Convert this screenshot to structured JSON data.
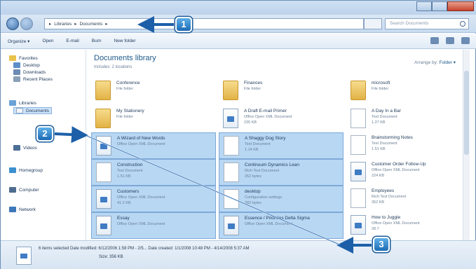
{
  "address": {
    "crumbs": [
      "Libraries",
      "Documents"
    ],
    "search_placeholder": "Search Documents"
  },
  "toolbar": {
    "items": [
      "Organize ▾",
      "Open",
      "E-mail",
      "Burn",
      "New folder"
    ]
  },
  "nav_pane": {
    "favorites": "Favorites",
    "desktop": "Desktop",
    "downloads": "Downloads",
    "recent_places": "Recent Places",
    "libraries": "Libraries",
    "documents": "Documents",
    "videos": "Videos",
    "homegroup": "Homegroup",
    "computer": "Computer",
    "network": "Network"
  },
  "library": {
    "title": "Documents library",
    "subtitle": "Includes: 2 locations",
    "arrange_label": "Arrange by:",
    "arrange_value": "Folder ▾"
  },
  "files": [
    {
      "name": "Conference",
      "type": "File folder",
      "size": "",
      "icon": "folder",
      "selected": false
    },
    {
      "name": "Finances",
      "type": "File folder",
      "size": "",
      "icon": "folder",
      "selected": false
    },
    {
      "name": "microsoft",
      "type": "File folder",
      "size": "",
      "icon": "folder",
      "selected": false
    },
    {
      "name": "My Stationery",
      "type": "File folder",
      "size": "",
      "icon": "folder",
      "selected": false
    },
    {
      "name": "A Draft E-mail Primer",
      "type": "Office Open XML Document",
      "size": "235 KB",
      "icon": "doc",
      "selected": false
    },
    {
      "name": "A Day In a Bar",
      "type": "Text Document",
      "size": "1.27 KB",
      "icon": "txt",
      "selected": false
    },
    {
      "name": "A Wizard of New Words",
      "type": "Office Open XML Document",
      "size": "",
      "icon": "doc",
      "selected": true
    },
    {
      "name": "A Shaggy Dog Story",
      "type": "Text Document",
      "size": "1.14 KB",
      "icon": "txt",
      "selected": true
    },
    {
      "name": "Brainstorming Notes",
      "type": "Text Document",
      "size": "1.51 KB",
      "icon": "txt",
      "selected": false
    },
    {
      "name": "Construction",
      "type": "Text Document",
      "size": "1.51 KB",
      "icon": "txt",
      "selected": true
    },
    {
      "name": "Continuum Dynamics Lean",
      "type": "Rich Text Document",
      "size": "262 bytes",
      "icon": "txt",
      "selected": true
    },
    {
      "name": "Customer Order Follow-Up",
      "type": "Office Open XML Document",
      "size": "224 KB",
      "icon": "doc",
      "selected": false
    },
    {
      "name": "Customers",
      "type": "Office Open XML Document",
      "size": "41.2 KB",
      "icon": "doc",
      "selected": true
    },
    {
      "name": "desktop",
      "type": "Configuration settings",
      "size": "282 bytes",
      "icon": "txt",
      "selected": true
    },
    {
      "name": "Employees",
      "type": "Rich Text Document",
      "size": "352 KB",
      "icon": "txt",
      "selected": false
    },
    {
      "name": "Essay",
      "type": "Office Open XML Document",
      "size": "",
      "icon": "doc",
      "selected": true
    },
    {
      "name": "Essence / Priorities Delta Sigma",
      "type": "Office Open XML Document",
      "size": "",
      "icon": "doc",
      "selected": true
    },
    {
      "name": "How to Juggle",
      "type": "Office Open XML Document",
      "size": "28.7",
      "icon": "doc",
      "selected": false
    }
  ],
  "details": {
    "line1": "6 items selected   Date modified: 6/12/2006 1:58 PM - 2/5...   Date created: 1/1/2008 10:48 PM - 4/14/2008 5:37 AM",
    "line2": "Size: 356 KB"
  },
  "callouts": [
    "1",
    "2",
    "3"
  ]
}
